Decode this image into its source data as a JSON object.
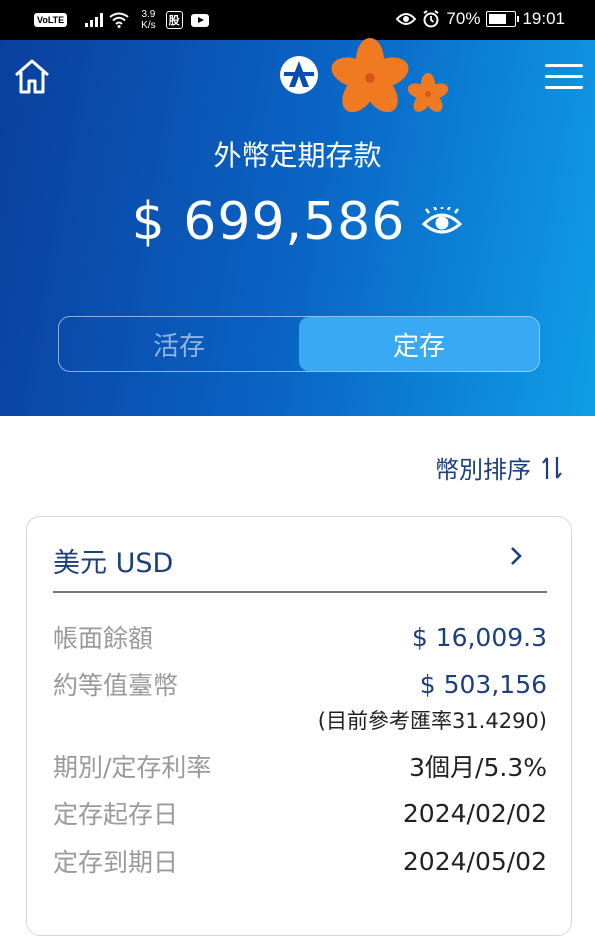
{
  "status_bar": {
    "volte": "VoLTE",
    "net_speed_value": "3.9",
    "net_speed_unit": "K/s",
    "stock_badge": "股",
    "battery": "70%",
    "time": "19:01"
  },
  "header": {
    "title": "外幣定期存款",
    "total_amount": "$ 699,586",
    "tabs": [
      {
        "label": "活存",
        "active": false
      },
      {
        "label": "定存",
        "active": true
      }
    ]
  },
  "sort": {
    "label": "幣別排序"
  },
  "card": {
    "currency_title": "美元 USD",
    "rows": {
      "book_balance": {
        "label": "帳面餘額",
        "value": "$ 16,009.3"
      },
      "twd_equivalent": {
        "label": "約等值臺幣",
        "value": "$ 503,156"
      },
      "rate_note": "(目前參考匯率31.4290)",
      "term_rate": {
        "label": "期別/定存利率",
        "value": "3個月/5.3%"
      },
      "start_date": {
        "label": "定存起存日",
        "value": "2024/02/02"
      },
      "maturity_date": {
        "label": "定存到期日",
        "value": "2024/05/02"
      }
    }
  },
  "colors": {
    "header_gradient_start": "#0a3f9e",
    "header_gradient_end": "#0f9ee6",
    "active_tab": "#3aa9f3",
    "navy_text": "#1b3f7f",
    "label_gray": "#9a9a9a",
    "flower_orange": "#f07a22"
  },
  "icons": [
    "home-icon",
    "bank-logo-icon",
    "flower-decoration",
    "menu-icon",
    "eye-icon",
    "sort-arrows-icon",
    "chevron-right-icon"
  ]
}
